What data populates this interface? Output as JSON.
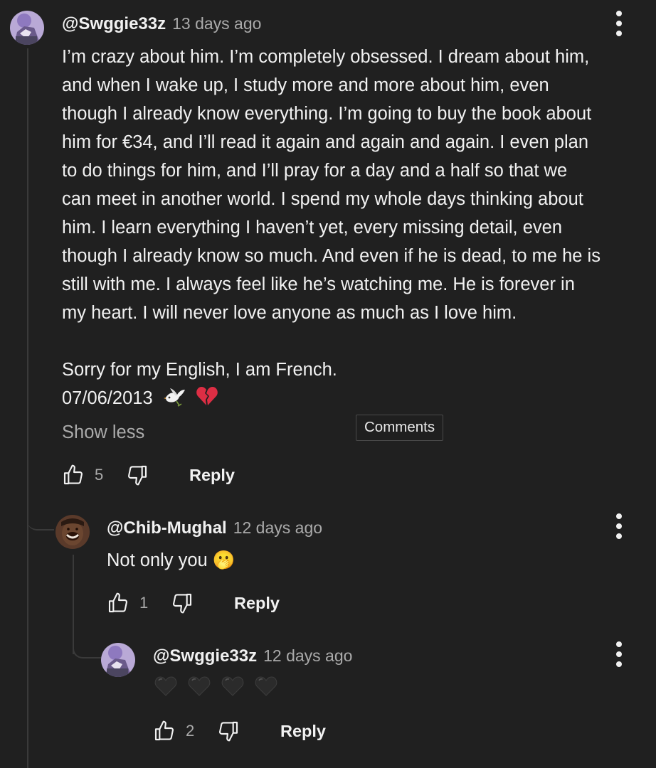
{
  "comments": [
    {
      "author": "@Swggie33z",
      "time": "13 days ago",
      "text": "I’m crazy about him. I’m completely obsessed. I dream about him,\nand when I wake up, I study more and more about him, even\nthough I already know everything. I’m going to buy the book about\nhim for €34, and I’ll read it again and again and again. I even plan\nto do things for him, and I’ll pray for a day and a half so that we\ncan meet in another world. I spend my whole days thinking about\nhim. I learn everything I haven’t yet, every missing detail, even\nthough I already know so much. And even if he is dead, to me he is\nstill with me. I always feel like he’s watching me. He is forever in\nmy heart. I will never love anyone as much as I love him.",
      "apology": "Sorry for my English, I am French.",
      "date_line": "07/06/2013",
      "date_emoji": [
        "dove-emoji",
        "broken-heart-emoji"
      ],
      "show_less": "Show less",
      "likes": "5",
      "reply": "Reply"
    },
    {
      "author": "@Chib-Mughal",
      "time": "12 days ago",
      "text": "Not only you 🫢",
      "likes": "1",
      "reply": "Reply"
    },
    {
      "author": "@Swggie33z",
      "time": "12 days ago",
      "text_emoji": [
        "black-heart-emoji",
        "black-heart-emoji",
        "black-heart-emoji",
        "black-heart-emoji"
      ],
      "likes": "2",
      "reply": "Reply"
    }
  ],
  "tooltip": "Comments",
  "icons": {
    "like": "thumbs-up-icon",
    "dislike": "thumbs-down-icon",
    "menu": "more-vertical-icon"
  },
  "colors": {
    "background": "#202020",
    "text": "#f1f1f1",
    "secondary": "#aaaaaa"
  }
}
